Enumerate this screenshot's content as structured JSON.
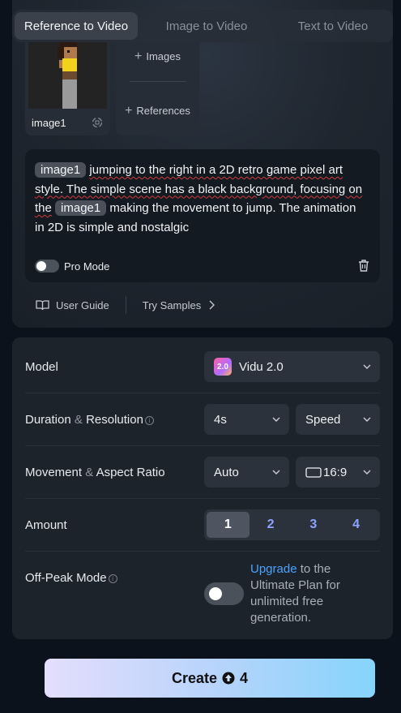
{
  "tabs": [
    {
      "label": "Reference to Video",
      "active": true
    },
    {
      "label": "Image to Video",
      "active": false
    },
    {
      "label": "Text to Video",
      "active": false
    }
  ],
  "references": {
    "thumb_label": "image1",
    "add_images": "Images",
    "add_references": "References"
  },
  "prompt": {
    "chip1": "image1",
    "text1": "jumping to the right in a 2D retro game pixel art style. The simple scene has a black background, focusing on the",
    "chip2": "image1",
    "text2": "making the movement to jump. The animation in 2D is simple and nostalgic",
    "pro_mode_label": "Pro Mode",
    "pro_mode_on": false
  },
  "links": {
    "user_guide": "User Guide",
    "try_samples": "Try Samples"
  },
  "settings": {
    "model_label": "Model",
    "model_value": "Vidu 2.0",
    "model_badge": "2.0",
    "duration_label_a": "Duration",
    "duration_label_amp": "&",
    "duration_label_b": "Resolution",
    "duration_value": "4s",
    "resolution_value": "Speed",
    "movement_label_a": "Movement",
    "movement_label_amp": "&",
    "movement_label_b": "Aspect Ratio",
    "movement_value": "Auto",
    "aspect_value": "16:9",
    "amount_label": "Amount",
    "amount_options": [
      "1",
      "2",
      "3",
      "4"
    ],
    "amount_selected": "1",
    "offpeak_label": "Off-Peak Mode",
    "offpeak_on": false,
    "upgrade_link": "Upgrade",
    "upgrade_text": " to the Ultimate Plan for unlimited free generation."
  },
  "create": {
    "label": "Create",
    "cost": "4"
  },
  "colors": {
    "accent_blue": "#4aa3ff",
    "amount_blue": "#8fa2ff",
    "create_gradient_start": "#e4defc",
    "create_gradient_end": "#86d4fb"
  }
}
